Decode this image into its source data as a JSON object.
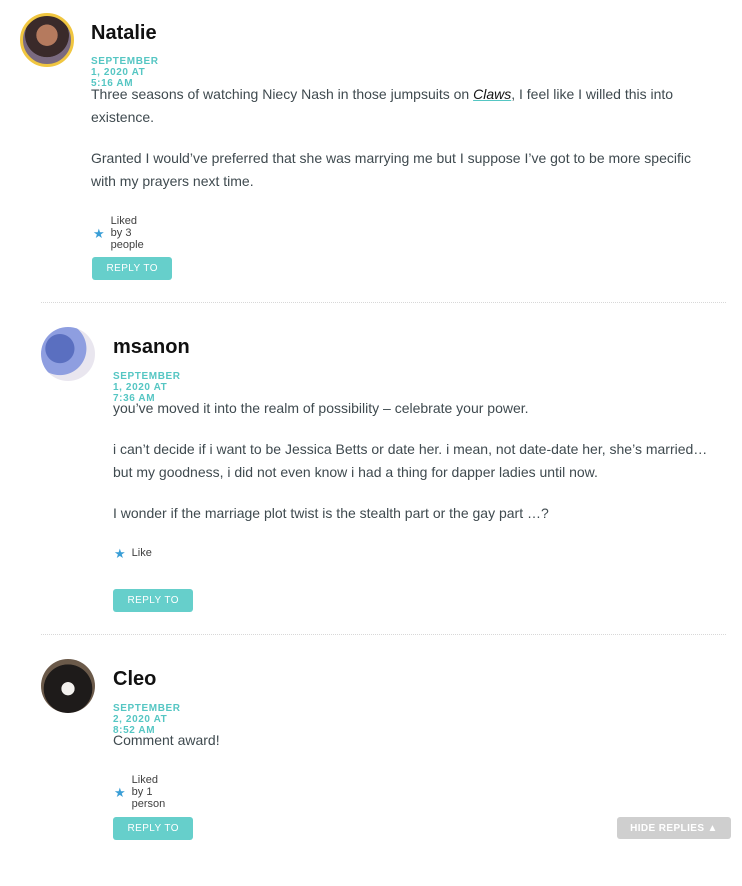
{
  "comments": [
    {
      "author": "Natalie",
      "date": "SEPTEMBER 1, 2020 AT 5:16 AM",
      "paragraphs": [
        {
          "before": "Three seasons of watching Niecy Nash in those jumpsuits on ",
          "link": "Claws",
          "after": ", I feel like I willed this into existence."
        },
        {
          "text": "Granted I would’ve preferred that she was marrying me but I suppose I’ve got to be more specific with my prayers next time."
        }
      ],
      "likes": "Liked by 3 people",
      "reply": "REPLY TO THIS COMMENT"
    },
    {
      "author": "msanon",
      "date": "SEPTEMBER 1, 2020 AT 7:36 AM",
      "paragraphs": [
        {
          "text": "you’ve moved it into the realm of possibility – celebrate your power."
        },
        {
          "text": "i can’t decide if i want to be Jessica Betts or date her. i mean, not date-date her, she’s married… but my goodness, i did not even know i had a thing for dapper ladies until now."
        },
        {
          "text": "I wonder if the marriage plot twist is the stealth part or the gay part …?"
        }
      ],
      "likes": "Like",
      "reply": "REPLY TO THIS COMMENT"
    },
    {
      "author": "Cleo",
      "date": "SEPTEMBER 2, 2020 AT 8:52 AM",
      "paragraphs": [
        {
          "text": "Comment award!"
        }
      ],
      "likes": "Liked by 1 person",
      "reply": "REPLY TO THIS COMMENT"
    }
  ],
  "hide_replies": "HIDE REPLIES ▲",
  "icons": {
    "like": "star-icon"
  },
  "colors": {
    "accent": "#55c6c3",
    "button": "#66cfcb",
    "star": "#3a9ed6"
  }
}
